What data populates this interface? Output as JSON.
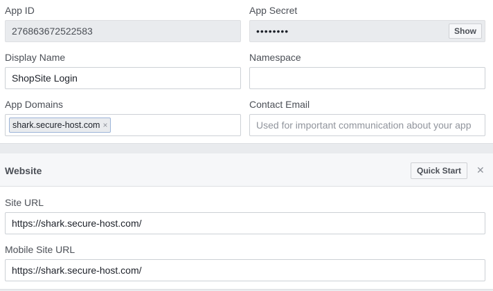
{
  "basic": {
    "app_id_label": "App ID",
    "app_id_value": "276863672522583",
    "app_secret_label": "App Secret",
    "app_secret_masked": "••••••••",
    "show_button": "Show",
    "display_name_label": "Display Name",
    "display_name_value": "ShopSite Login",
    "namespace_label": "Namespace",
    "namespace_value": "",
    "app_domains_label": "App Domains",
    "app_domains_tokens": [
      "shark.secure-host.com"
    ],
    "token_remove": "×",
    "contact_email_label": "Contact Email",
    "contact_email_placeholder": "Used for important communication about your app"
  },
  "website": {
    "title": "Website",
    "quick_start_button": "Quick Start",
    "close_glyph": "✕",
    "site_url_label": "Site URL",
    "site_url_value": "https://shark.secure-host.com/",
    "mobile_site_url_label": "Mobile Site URL",
    "mobile_site_url_value": "https://shark.secure-host.com/"
  }
}
